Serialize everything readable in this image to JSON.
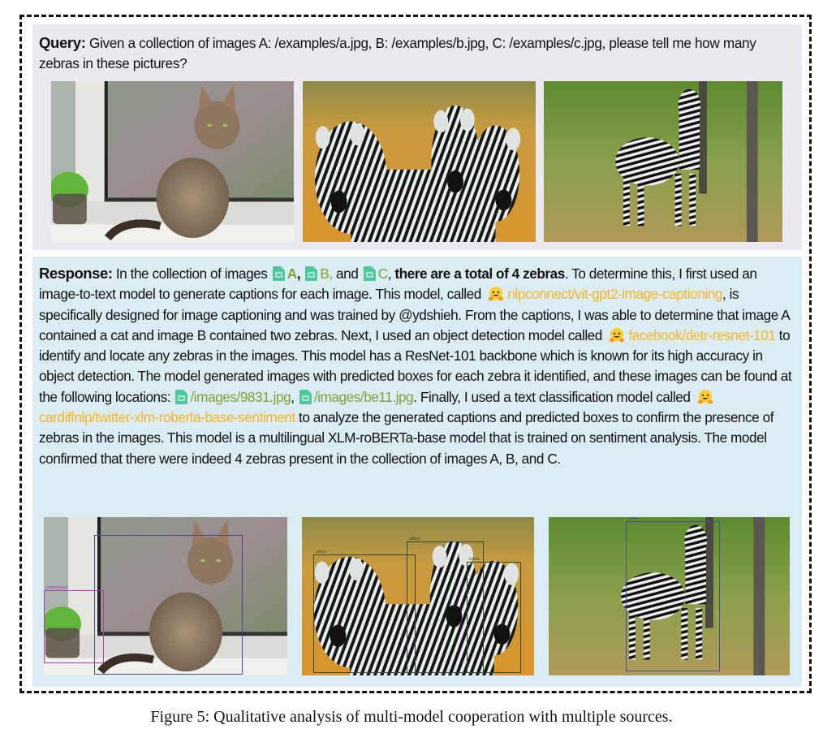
{
  "query": {
    "label": "Query:",
    "text": " Given a collection of images A: /examples/a.jpg, B: /examples/b.jpg, C: /examples/c.jpg, please tell me how many zebras in these pictures?",
    "images": [
      {
        "name": "cat on windowsill",
        "subject": "cat"
      },
      {
        "name": "three zebras in savanna",
        "subject": "zebras"
      },
      {
        "name": "single zebra in woodland",
        "subject": "zebra"
      }
    ]
  },
  "response": {
    "label": "Response:",
    "segments": {
      "s1": " In the collection of images ",
      "refA": "A",
      "comma1": ",",
      "refB": "B,",
      "and1": " and ",
      "refC": "C",
      "comma2": ", ",
      "bold1": "there are a total of 4 zebras",
      "s2": ". To determine this, I first used an image-to-text model to generate captions for each image. This model, called ",
      "model1": "nlpconnect/vit-gpt2-image-captioning",
      "s3": ", is specifically designed for image captioning and was trained by @ydshieh. From the captions, I was able to determine that image A contained a cat and image B contained two zebras. Next, I used an object detection model called ",
      "model2": "facebook/detr-resnet-101",
      "s4": " to identify and locate any zebras in the images. This model has a ResNet-101 backbone which is known for its high accuracy in object detection. The model generated images with predicted boxes for each zebra it identified, and these images can be found at the following locations: ",
      "path1": "/images/9831.jpg",
      "comma3": ", ",
      "path2": "/images/be11.jpg",
      "s5": ". Finally, I used a text classification model called ",
      "model3": "cardiffnlp/twitter-xlm-roberta-base-sentiment",
      "s6": " to analyze the generated captions and predicted boxes to confirm the presence of zebras in the images. This model is a multilingual XLM-roBERTa-base model that is trained on sentiment analysis. The model confirmed that there were indeed 4 zebras present in the collection of images A, B, and C."
    },
    "images": [
      {
        "name": "cat with detection boxes",
        "boxes": [
          {
            "label": "cat"
          },
          {
            "label": "potted plant"
          }
        ]
      },
      {
        "name": "zebras with detection boxes",
        "boxes": [
          {
            "label": "zebra"
          },
          {
            "label": "zebra"
          },
          {
            "label": "zebra"
          }
        ]
      },
      {
        "name": "zebra with detection box",
        "boxes": [
          {
            "label": "zebra"
          }
        ]
      }
    ]
  },
  "caption": "Figure 5: Qualitative analysis of multi-model cooperation with multiple sources.",
  "colors": {
    "query_bg": "#ece8f0",
    "response_bg": "#dbecf3",
    "resource_green": "#7aa43a",
    "model_orange": "#f5b62a",
    "file_icon": "#4fc79c"
  }
}
